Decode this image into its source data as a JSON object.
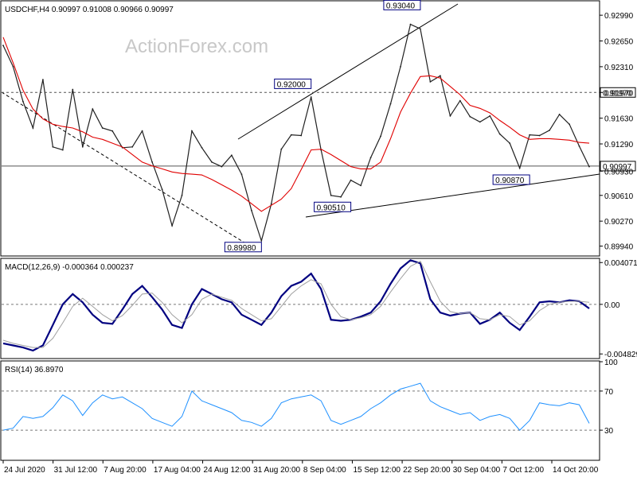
{
  "watermark": "ActionForex.com",
  "chart_data": [
    {
      "panel": "price",
      "type": "line",
      "header": "USDCHF,H4  0.90997 0.91008 0.90966 0.90997",
      "symbol": "USDCHF",
      "timeframe": "H4",
      "ohlc_last": [
        0.90997,
        0.91008,
        0.90966,
        0.90997
      ],
      "ylim": [
        0.8982,
        0.9317
      ],
      "y_ticks": [
        0.8994,
        0.9027,
        0.9061,
        0.9093,
        0.9129,
        0.9163,
        0.9197,
        0.9231,
        0.9265,
        0.9299
      ],
      "y_tick_labels": [
        "0.89940",
        "0.90270",
        "0.90610",
        "0.90930",
        "0.91290",
        "0.91630",
        "0.91970",
        "0.92310",
        "0.92650",
        "0.92990"
      ],
      "x_tick_labels": [
        "24 Jul 2020",
        "31 Jul 12:00",
        "7 Aug 20:00",
        "17 Aug 04:00",
        "24 Aug 12:00",
        "31 Aug 20:00",
        "8 Sep 04:00",
        "15 Sep 12:00",
        "22 Sep 20:00",
        "30 Sep 04:00",
        "7 Oct 12:00",
        "14 Oct 20:00"
      ],
      "series": [
        {
          "name": "",
          "style": "close",
          "color": "#202020",
          "values": [
            0.9259,
            0.9231,
            0.9185,
            0.915,
            0.9214,
            0.9125,
            0.9121,
            0.9201,
            0.9125,
            0.9175,
            0.915,
            0.9146,
            0.9124,
            0.9125,
            0.9146,
            0.9105,
            0.9069,
            0.9021,
            0.9061,
            0.9146,
            0.9124,
            0.9105,
            0.9099,
            0.9114,
            0.9089,
            0.9041,
            0.9001,
            0.905,
            0.9122,
            0.9141,
            0.914,
            0.9191,
            0.9121,
            0.9061,
            0.9059,
            0.9081,
            0.9074,
            0.9111,
            0.9139,
            0.9182,
            0.9231,
            0.9287,
            0.9281,
            0.9211,
            0.9219,
            0.9166,
            0.9186,
            0.9165,
            0.9158,
            0.9166,
            0.9142,
            0.913,
            0.9097,
            0.9141,
            0.914,
            0.9147,
            0.9168,
            0.9155,
            0.9126,
            0.9099
          ]
        },
        {
          "name": "",
          "style": "moving-average",
          "color": "#e00000",
          "values": [
            0.927,
            0.9236,
            0.92,
            0.9175,
            0.9162,
            0.9155,
            0.9152,
            0.915,
            0.9145,
            0.9138,
            0.9135,
            0.913,
            0.9125,
            0.9115,
            0.9105,
            0.91,
            0.9096,
            0.9092,
            0.909,
            0.9089,
            0.9088,
            0.9082,
            0.9075,
            0.9068,
            0.906,
            0.905,
            0.904,
            0.9048,
            0.9056,
            0.907,
            0.9095,
            0.9121,
            0.9122,
            0.9115,
            0.9107,
            0.9099,
            0.9096,
            0.9096,
            0.9105,
            0.9136,
            0.9171,
            0.9196,
            0.9218,
            0.9219,
            0.9216,
            0.9205,
            0.9194,
            0.918,
            0.9176,
            0.917,
            0.916,
            0.9151,
            0.9141,
            0.9135,
            0.9136,
            0.9136,
            0.9135,
            0.9134,
            0.9131,
            0.913
          ]
        }
      ],
      "horizontal_lines": [
        {
          "value": 0.9197,
          "style": "dashed",
          "label": "0.91970"
        },
        {
          "value": 0.90997,
          "style": "solid",
          "label": "0.90997"
        }
      ],
      "annotations": [
        {
          "label": "0.89980",
          "value": 0.8998
        },
        {
          "label": "0.92000",
          "value": 0.92
        },
        {
          "label": "0.90510",
          "value": 0.9051
        },
        {
          "label": "0.93040",
          "value": 0.9304
        },
        {
          "label": "0.90870",
          "value": 0.9087
        }
      ]
    },
    {
      "panel": "macd",
      "type": "line",
      "header": "MACD(12,26,9) -0.000364 0.000237",
      "ylim": [
        -0.0052,
        0.0044
      ],
      "y_tick_labels": [
        "0.004071",
        "0.00",
        "-0.004829"
      ],
      "y_ticks": [
        0.004071,
        0.0,
        -0.004829
      ],
      "series": [
        {
          "name": "",
          "color": "#000080",
          "values": [
            -0.0038,
            -0.004,
            -0.0042,
            -0.0045,
            -0.004,
            -0.002,
            0.0,
            0.001,
            0.0002,
            -0.001,
            -0.0018,
            -0.0019,
            -0.0005,
            0.001,
            0.0018,
            0.0007,
            -0.0005,
            -0.002,
            -0.0023,
            0.0,
            0.0015,
            0.001,
            0.0005,
            0.0002,
            -0.001,
            -0.0015,
            -0.002,
            -0.0008,
            0.0008,
            0.0018,
            0.0022,
            0.003,
            0.0015,
            -0.0015,
            -0.0016,
            -0.0015,
            -0.0012,
            -0.0008,
            0.0003,
            0.002,
            0.0035,
            0.0043,
            0.004,
            0.0005,
            -0.0008,
            -0.0011,
            -0.0009,
            -0.0008,
            -0.0019,
            -0.0015,
            -0.0008,
            -0.0018,
            -0.0025,
            -0.0012,
            0.0002,
            0.0003,
            0.0002,
            0.0004,
            0.0003,
            -0.0004
          ]
        },
        {
          "name": "",
          "color": "#a0a0a0",
          "values": [
            -0.0035,
            -0.0038,
            -0.004,
            -0.0042,
            -0.0042,
            -0.0033,
            -0.0018,
            -0.0002,
            0.0006,
            -0.0002,
            -0.001,
            -0.0016,
            -0.0011,
            -0.0001,
            0.001,
            0.0011,
            0.0002,
            -0.001,
            -0.0018,
            -0.001,
            0.0005,
            0.001,
            0.0007,
            0.0004,
            -0.0004,
            -0.001,
            -0.0016,
            -0.0014,
            -0.0002,
            0.001,
            0.0018,
            0.0024,
            0.002,
            0.0,
            -0.0012,
            -0.0015,
            -0.0013,
            -0.001,
            -0.0002,
            0.0012,
            0.0025,
            0.0037,
            0.0042,
            0.0022,
            0.0003,
            -0.0007,
            -0.0009,
            -0.0008,
            -0.0014,
            -0.0015,
            -0.001,
            -0.0012,
            -0.002,
            -0.0016,
            -0.0006,
            0.0,
            0.0002,
            0.0003,
            0.0003,
            0.0002
          ]
        }
      ]
    },
    {
      "panel": "rsi",
      "type": "line",
      "header": "RSI(14) 36.8970",
      "ylim": [
        0,
        100
      ],
      "y_ticks": [
        100,
        70,
        30
      ],
      "y_tick_labels": [
        "100",
        "70",
        "30"
      ],
      "levels": [
        70,
        30
      ],
      "series": [
        {
          "name": "",
          "color": "#1e90ff",
          "values": [
            30,
            32,
            44,
            42,
            44,
            53,
            66,
            60,
            45,
            58,
            66,
            62,
            64,
            58,
            52,
            42,
            38,
            34,
            44,
            70,
            60,
            56,
            52,
            48,
            40,
            38,
            34,
            42,
            58,
            62,
            64,
            66,
            60,
            40,
            36,
            40,
            44,
            52,
            58,
            66,
            72,
            75,
            78,
            60,
            54,
            50,
            46,
            48,
            40,
            44,
            46,
            42,
            30,
            40,
            58,
            56,
            55,
            58,
            56,
            37
          ]
        }
      ]
    }
  ]
}
